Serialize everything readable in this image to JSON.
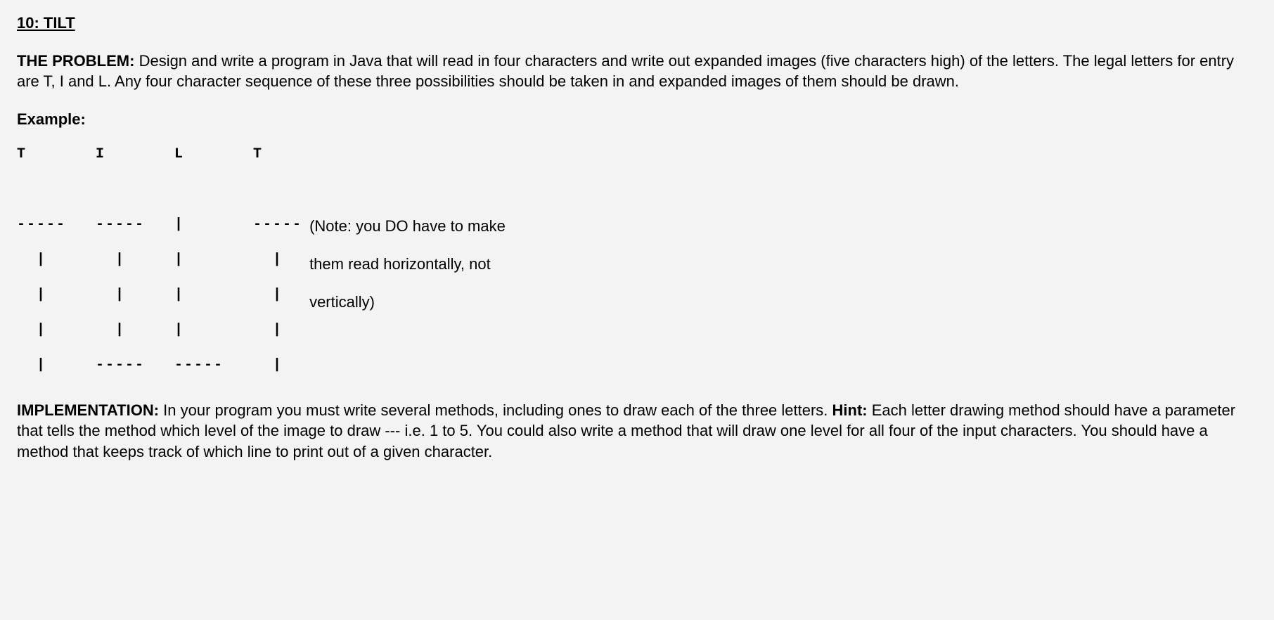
{
  "heading": "10: TILT",
  "problem_label": "THE PROBLEM:",
  "problem_text": " Design and write a program in Java that will read in four characters and write out expanded images (five characters high) of the letters.  The legal letters for entry are T, I and L.  Any four character sequence of these three possibilities should be taken in and expanded images of them should be drawn.",
  "example_label": "Example:",
  "ascii_art": "T       I       L       T\n\n-----   -----   |       -----\n  |       |     |         |  \n  |       |     |         |  \n  |       |     |         |  \n  |     -----   -----     |  ",
  "note_lines": [
    "(Note: you DO have to make",
    "them read horizontally, not",
    "vertically)"
  ],
  "implementation_label": "IMPLEMENTATION:",
  "implementation_text_1": " In your program you must write several methods, including ones to draw each of the three letters.  ",
  "hint_label": "Hint:",
  "implementation_text_2": " Each letter drawing method should have a parameter that tells the method which level of the image to draw --- i.e. 1 to 5.  You could also write a method that will draw one level for all four of the input characters.  You should have a method that keeps track of which line to print out of a given character."
}
